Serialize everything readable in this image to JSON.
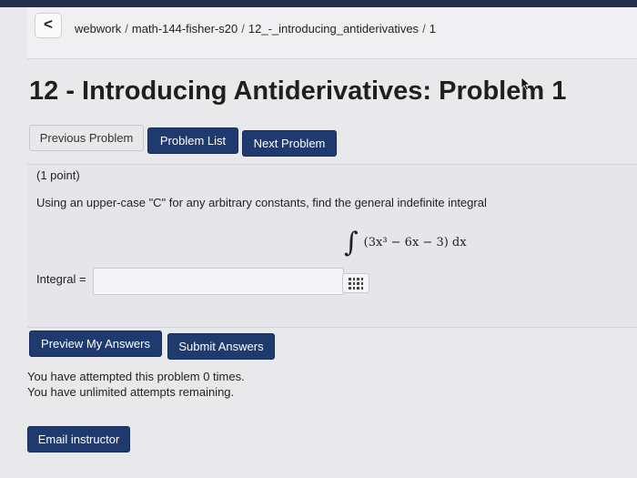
{
  "breadcrumb": {
    "back_label": "<",
    "items": [
      "webwork",
      "math-144-fisher-s20",
      "12_-_introducing_antiderivatives",
      "1"
    ],
    "separator": "/"
  },
  "page_title": "12 - Introducing Antiderivatives: Problem 1",
  "nav": {
    "previous": "Previous Problem",
    "list": "Problem List",
    "next": "Next Problem"
  },
  "problem": {
    "points": "(1 point)",
    "prompt": "Using an upper-case \"C\" for any arbitrary constants, find the general indefinite integral",
    "integral_sign": "∫",
    "integral_expression": "(3x³ − 6x − 3) dx",
    "answer_label": "Integral =",
    "answer_value": ""
  },
  "actions": {
    "preview": "Preview My Answers",
    "submit": "Submit Answers"
  },
  "status": {
    "attempted": "You have attempted this problem 0 times.",
    "remaining": "You have unlimited attempts remaining."
  },
  "email_button": "Email instructor",
  "colors": {
    "primary_button": "#1e3a6e",
    "top_band": "#23314f",
    "background": "#e9e9ec"
  },
  "icons": [
    "cursor-icon",
    "matrix-grid-icon"
  ]
}
